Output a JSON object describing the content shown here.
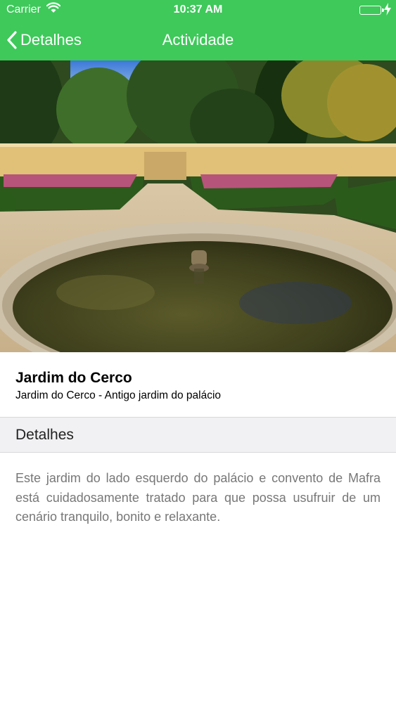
{
  "status_bar": {
    "carrier": "Carrier",
    "time": "10:37 AM"
  },
  "nav": {
    "back_label": "Detalhes",
    "title": "Actividade",
    "bar_color": "#3ec95a"
  },
  "hero": {
    "subject": "garden with round fountain pond"
  },
  "activity": {
    "title": "Jardim do Cerco",
    "subtitle": "Jardim do Cerco - Antigo jardim do palácio"
  },
  "details": {
    "section_header": "Detalhes",
    "description": "Este jardim do lado esquerdo do palácio e convento de Mafra está cuidadosamente tratado para que possa usufruir de um cenário tranquilo, bonito e relaxante."
  }
}
